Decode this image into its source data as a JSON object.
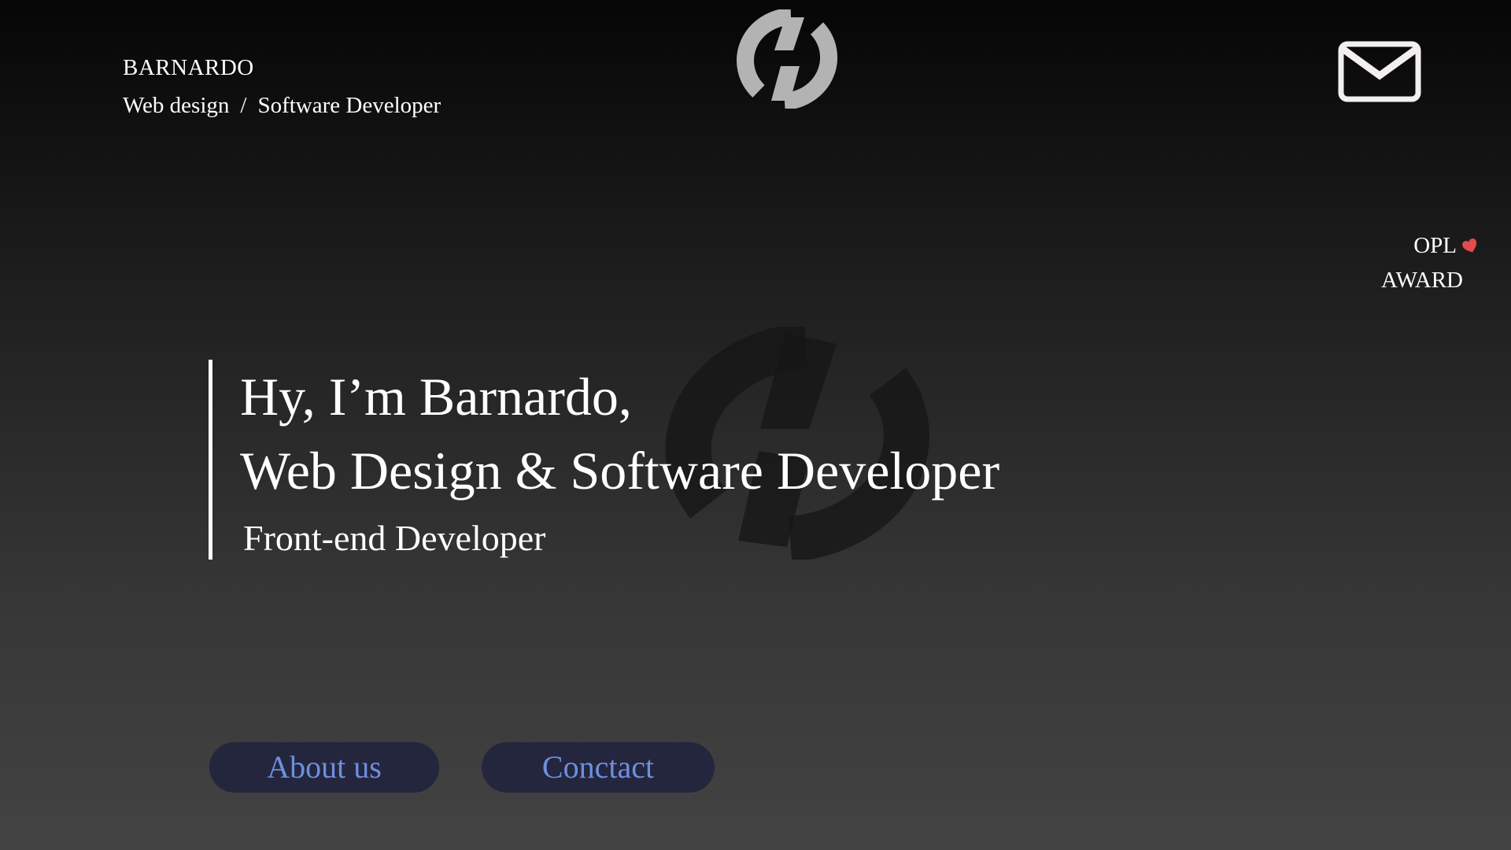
{
  "header": {
    "brand_name": "BARNARDO",
    "role_primary": "Web design",
    "role_separator": "/",
    "role_secondary": "Software Developer",
    "logo_icon": "brand-logo-icon",
    "mail_icon": "mail-icon"
  },
  "award": {
    "line1": "OPL",
    "line2": "AWARD",
    "icon": "heart-icon",
    "icon_color": "#e24b4b"
  },
  "hero": {
    "greeting": "Hy, I’m Barnardo,",
    "title": "Web Design & Software Developer",
    "subtitle": "Front-end Developer"
  },
  "actions": {
    "about_label": "About us",
    "contact_label": "Conctact"
  },
  "colors": {
    "button_bg": "#24263d",
    "button_text": "#6e8fe0",
    "logo_gray": "#b3b3b3"
  }
}
